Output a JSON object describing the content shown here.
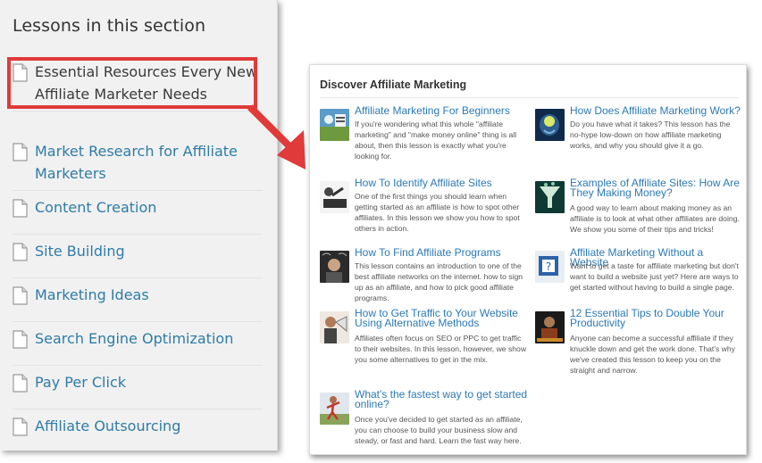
{
  "sidebar": {
    "title": "Lessons in this section",
    "items": [
      {
        "label": "Essential Resources Every New Affiliate Marketer Needs",
        "icon": "page-icon",
        "active": true
      },
      {
        "label": "Market Research for Affiliate Marketers",
        "icon": "page-icon"
      },
      {
        "label": "Content Creation",
        "icon": "page-icon"
      },
      {
        "label": "Site Building",
        "icon": "page-icon"
      },
      {
        "label": "Marketing Ideas",
        "icon": "page-icon"
      },
      {
        "label": "Search Engine Optimization",
        "icon": "page-icon"
      },
      {
        "label": "Pay Per Click",
        "icon": "page-icon"
      },
      {
        "label": "Affiliate Outsourcing",
        "icon": "page-icon"
      }
    ]
  },
  "panel": {
    "title": "Discover Affiliate Marketing",
    "cards": [
      {
        "title": "Affiliate Marketing For Beginners",
        "desc": "If you're wondering what this whole \"affiliate marketing\" and \"make money online\" thing is all about, then this lesson is exactly what you're looking for.",
        "thumb": "beginners-thumbnail"
      },
      {
        "title": "How Does Affiliate Marketing Work?",
        "desc": "Do you have what it takes? This lesson has the no-hype low-down on how affiliate marketing works, and why you should give it a go.",
        "thumb": "brain-thumbnail"
      },
      {
        "title": "How To Identify Affiliate Sites",
        "desc": "One of the first things you should learn when getting started as an affiliate is how to spot other affiliates. In this lesson we show you how to spot others in action.",
        "thumb": "identify-thumbnail"
      },
      {
        "title": "Examples of Affiliate Sites: How Are They Making Money?",
        "desc": "A good way to learn about making money as an affiliate is to look at what other affiliates are doing. We show you some of their tips and tricks!",
        "thumb": "funnel-thumbnail"
      },
      {
        "title": "How To Find Affiliate Programs",
        "desc": "This lesson contains an introduction to one of the best affiliate networks on the internet. how to sign up as an affiliate, and how to pick good affiliate programs.",
        "thumb": "thinking-thumbnail"
      },
      {
        "title": "Affiliate Marketing Without a Website",
        "desc": "Want to get a taste for affiliate marketing but don't want to build a website just yet? Here are ways to get started without having to build a single page.",
        "thumb": "question-thumbnail"
      },
      {
        "title": "How to Get Traffic to Your Website Using Alternative Methods",
        "desc": "Affiliates often focus on SEO or PPC to get traffic to their websites. In this lesson, however, we show you some alternatives to get in the mix.",
        "thumb": "megaphone-thumbnail"
      },
      {
        "title": "12 Essential Tips to Double Your Productivity",
        "desc": "Anyone can become a successful affiliate if they knuckle down and get the work done. That's why we've created this lesson to keep you on the straight and narrow.",
        "thumb": "productivity-thumbnail"
      },
      {
        "title": "What's the fastest way to get started online?",
        "desc": "Once you've decided to get started as an affiliate, you can choose to build your business slow and steady, or fast and hard. Learn the fast way here.",
        "thumb": "runner-thumbnail"
      }
    ]
  },
  "colors": {
    "highlight": "#e03a3a",
    "link": "#2c79b5",
    "sidebar_link": "#2e7ca6"
  }
}
